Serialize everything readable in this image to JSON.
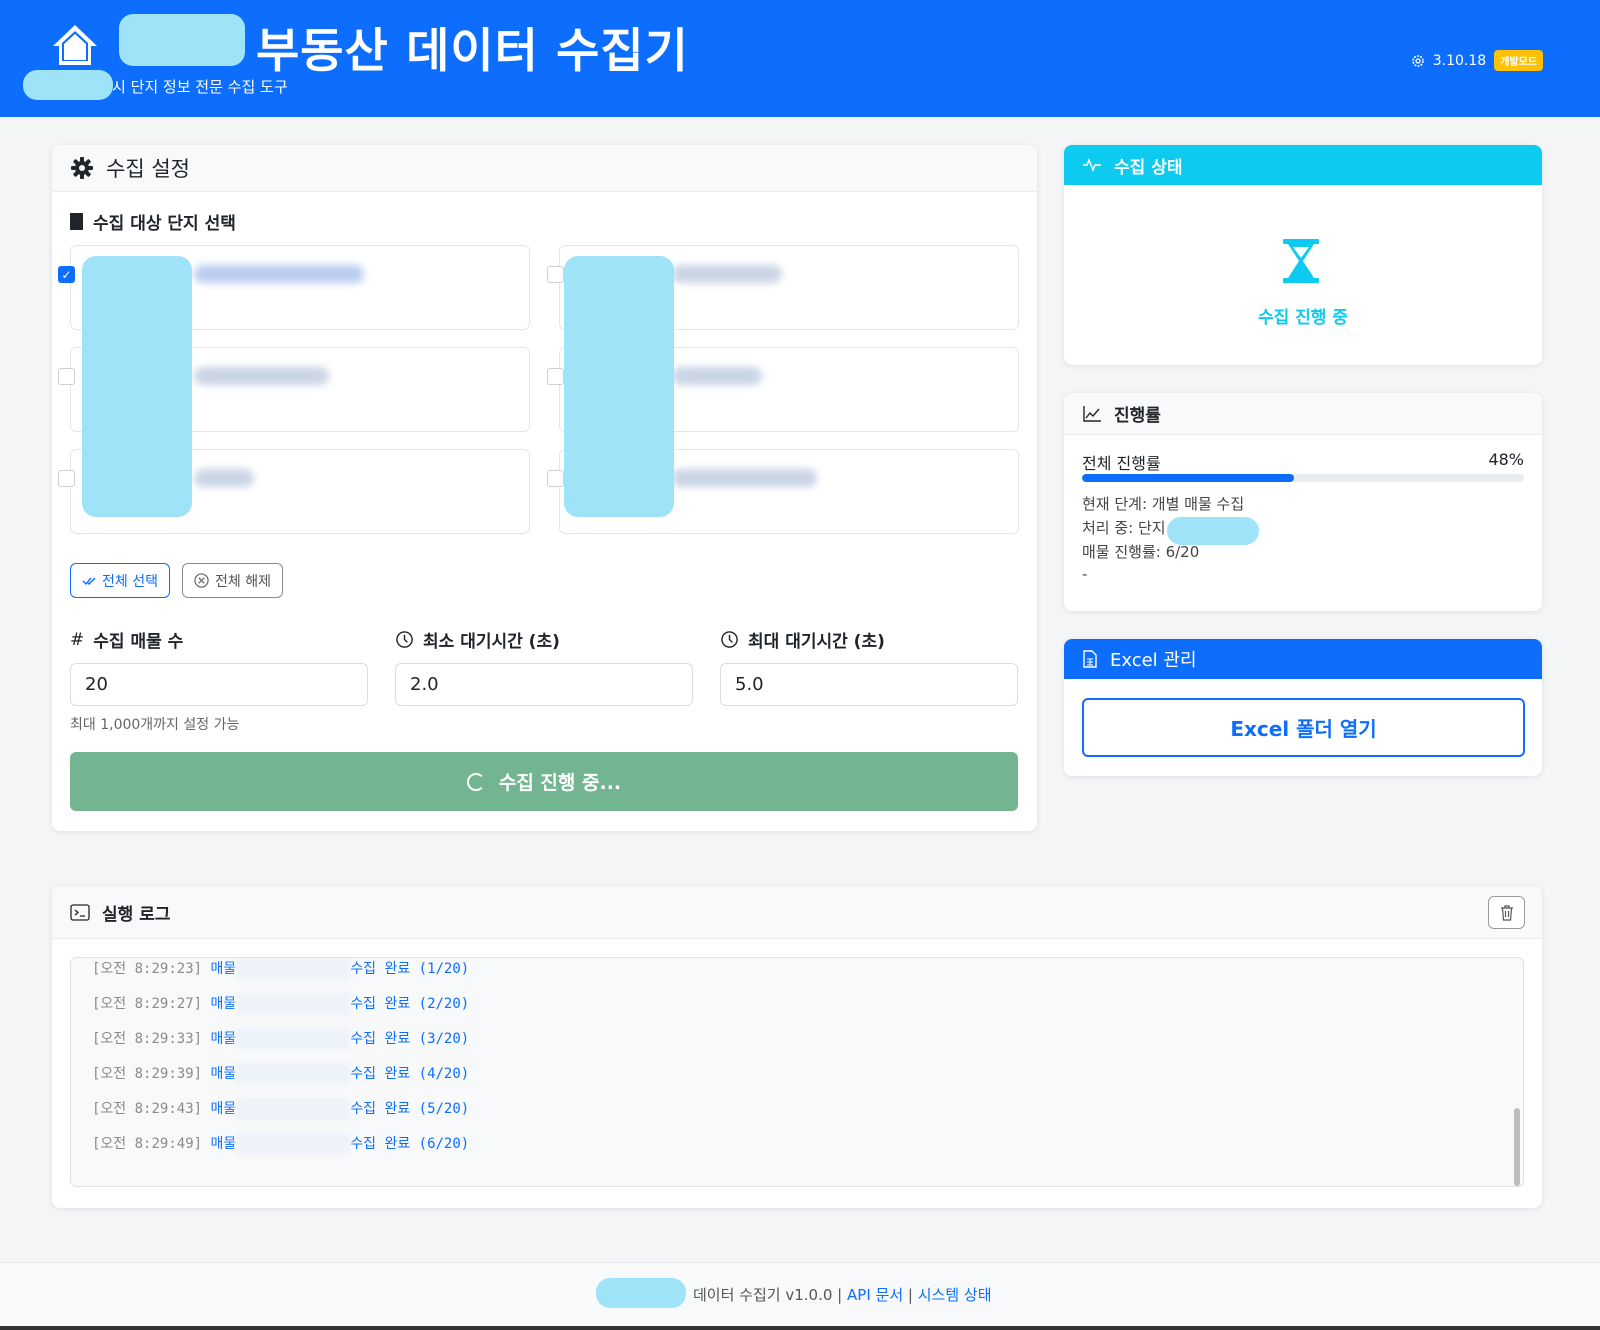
{
  "header": {
    "title": "부동산 데이터 수집기",
    "subtitle": "시 단지 정보 전문 수집 도구",
    "version": "3.10.18",
    "mode_badge": "개발모드"
  },
  "settings": {
    "title": "수집 설정",
    "target_label": "수집 대상 단지 선택",
    "complexes": [
      {
        "checked": true
      },
      {
        "checked": false
      },
      {
        "checked": false
      },
      {
        "checked": false
      },
      {
        "checked": false
      },
      {
        "checked": false
      }
    ],
    "select_all_label": "전체 선택",
    "deselect_all_label": "전체 해제",
    "count_label": "수집 매물 수",
    "count_value": "20",
    "min_wait_label": "최소 대기시간 (초)",
    "min_wait_value": "2.0",
    "max_wait_label": "최대 대기시간 (초)",
    "max_wait_value": "5.0",
    "help_text": "최대 1,000개까지 설정 가능",
    "run_button_label": "수집 진행 중..."
  },
  "status": {
    "title": "수집 상태",
    "text": "수집 진행 중"
  },
  "progress": {
    "title": "진행률",
    "overall_label": "전체 진행률",
    "overall_percent_text": "48%",
    "overall_fraction": 0.48,
    "current_stage": "현재 단계: 개별 매물 수집",
    "processing": "처리 중: 단지",
    "listing_progress": "매물 진행률: 6/20",
    "extra": "-"
  },
  "excel": {
    "title": "Excel 관리",
    "open_folder_label": "Excel 폴더 열기"
  },
  "log": {
    "title": "실행 로그",
    "entries": [
      {
        "time": "[오전 8:29:23]",
        "prefix": "매물",
        "suffix": "수집 완료 (1/20)"
      },
      {
        "time": "[오전 8:29:27]",
        "prefix": "매물",
        "suffix": "수집 완료 (2/20)"
      },
      {
        "time": "[오전 8:29:33]",
        "prefix": "매물",
        "suffix": "수집 완료 (3/20)"
      },
      {
        "time": "[오전 8:29:39]",
        "prefix": "매물",
        "suffix": "수집 완료 (4/20)"
      },
      {
        "time": "[오전 8:29:43]",
        "prefix": "매물",
        "suffix": "수집 완료 (5/20)"
      },
      {
        "time": "[오전 8:29:49]",
        "prefix": "매물",
        "suffix": "수집 완료 (6/20)"
      }
    ]
  },
  "footer": {
    "product": "데이터 수집기 v1.0.0",
    "sep": "|",
    "api_docs": "API 문서",
    "system_status": "시스템 상태"
  },
  "colors": {
    "primary": "#0d6efd",
    "info": "#0dcaf0",
    "running_button": "#74b591",
    "badge": "#ffc107"
  }
}
